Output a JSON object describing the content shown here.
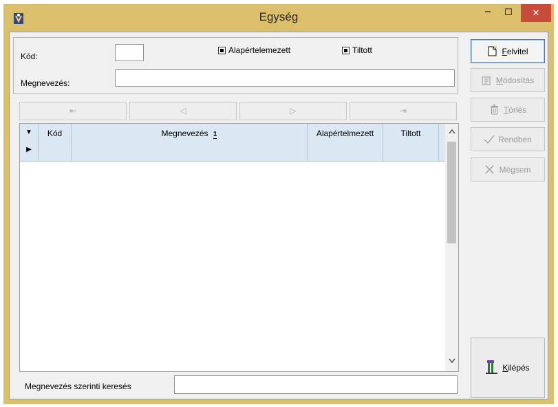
{
  "window": {
    "title": "Egység"
  },
  "titlebar": {
    "minimize": "–",
    "maximize": "☐",
    "close": "✕"
  },
  "form": {
    "kod_label": "Kód:",
    "kod_value": "",
    "megnevezes_label": "Megnevezés:",
    "megnevezes_value": "",
    "alap_label": "Alapértelemezett",
    "tiltott_label": "Tiltott"
  },
  "nav": {
    "first": "⇤",
    "prev": "◁",
    "next": "▷",
    "last": "⇥"
  },
  "grid": {
    "columns": [
      "Kód",
      "Megnevezés",
      "Alapértelmezett",
      "Tiltott"
    ],
    "sort_indicator": "1",
    "row_marker_down": "▼",
    "row_marker_current": "▶"
  },
  "search": {
    "label": "Megnevezés szerinti keresés",
    "value": ""
  },
  "side": {
    "felvitel_hot": "F",
    "felvitel_rest": "elvitel",
    "modositas_hot": "M",
    "modositas_rest": "ódosítás",
    "torles_hot": "T",
    "torles_rest": "örlés",
    "rendben": "Rendben",
    "megsem": "Mégsem",
    "kilepes_hot": "K",
    "kilepes_rest": "ilépés"
  },
  "colors": {
    "frame": "#dcbf6a",
    "close": "#c74c3c",
    "grid_header": "#dbe7f3"
  }
}
